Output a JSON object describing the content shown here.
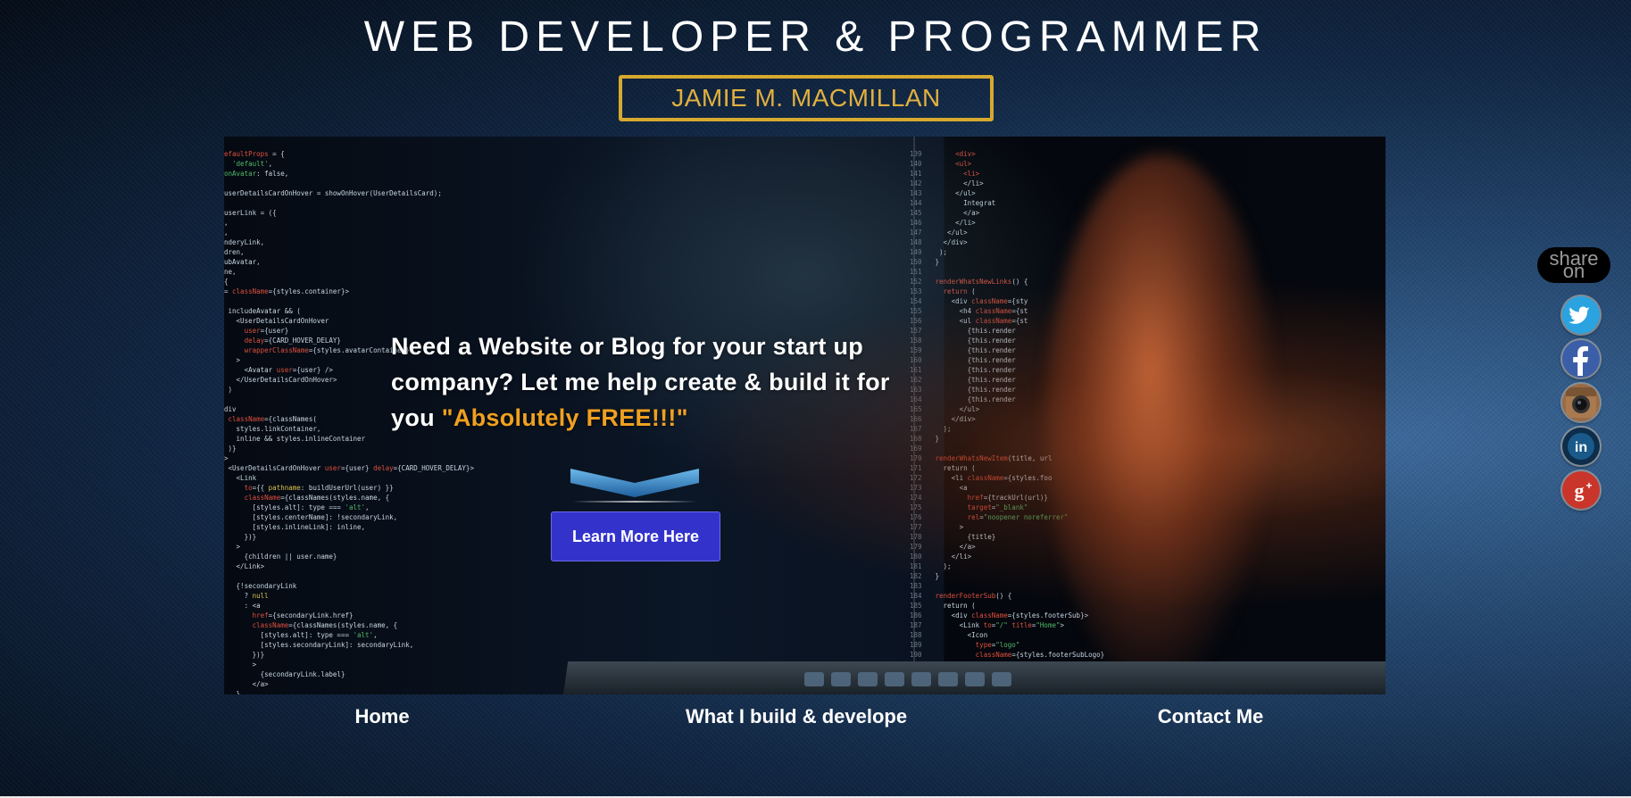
{
  "header": {
    "title": "WEB DEVELOPER & PROGRAMMER",
    "name": "JAMIE M. MACMILLAN"
  },
  "hero": {
    "message": "Need a Website or Blog for your start up company? Let me help create & build it for you",
    "highlight": "\"Absolutely FREE!!!\"",
    "cta_label": "Learn More Here"
  },
  "nav": {
    "items": [
      {
        "label": "Home"
      },
      {
        "label": "What I build & develope"
      },
      {
        "label": "Contact Me"
      }
    ]
  },
  "share": {
    "label_line1": "share",
    "label_line2": "on",
    "icons": [
      "twitter-icon",
      "facebook-icon",
      "instagram-icon",
      "linkedin-icon",
      "google-plus-icon"
    ]
  },
  "colors": {
    "accent_gold": "#d6a92f",
    "highlight_orange": "#f0a020",
    "button_blue": "#3333cc",
    "arrow_blue": "#3f8fd0"
  }
}
